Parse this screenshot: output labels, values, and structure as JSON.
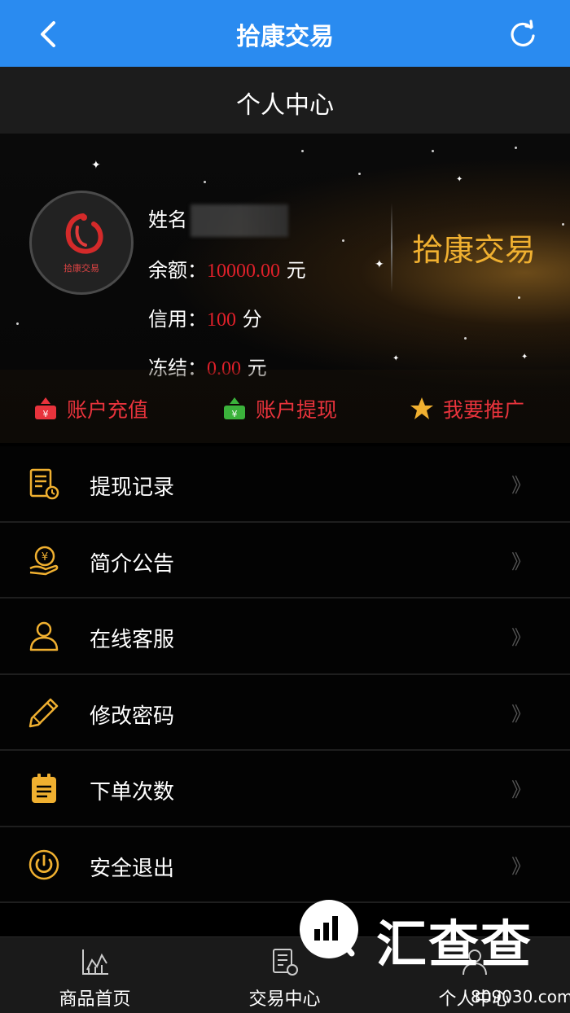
{
  "topbar": {
    "title": "拾康交易"
  },
  "subbar": {
    "title": "个人中心"
  },
  "profile": {
    "name_label": "姓名",
    "balance_label": "余额：",
    "balance_value": "10000.00",
    "balance_unit": "元",
    "credit_label": "信用：",
    "credit_value": "100",
    "credit_unit": "分",
    "frozen_label": "冻结：",
    "frozen_value": "0.00",
    "frozen_unit": "元",
    "avatar_text": "拾康交易",
    "brand": "拾康交易"
  },
  "actions": [
    {
      "label": "账户充值",
      "icon": "deposit-icon"
    },
    {
      "label": "账户提现",
      "icon": "withdraw-icon"
    },
    {
      "label": "我要推广",
      "icon": "star-icon"
    }
  ],
  "menu": [
    {
      "label": "提现记录",
      "icon": "record-icon"
    },
    {
      "label": "简介公告",
      "icon": "money-hand-icon"
    },
    {
      "label": "在线客服",
      "icon": "user-icon"
    },
    {
      "label": "修改密码",
      "icon": "pencil-icon"
    },
    {
      "label": "下单次数",
      "icon": "clipboard-icon"
    },
    {
      "label": "安全退出",
      "icon": "power-icon"
    }
  ],
  "menu_chevron": "》",
  "tabs": [
    {
      "label": "商品首页",
      "icon": "chart-icon"
    },
    {
      "label": "交易中心",
      "icon": "document-icon"
    },
    {
      "label": "个人中心",
      "icon": "person-icon"
    }
  ],
  "watermark": {
    "brand": "汇查查",
    "url": "809030.com"
  },
  "colors": {
    "nav_blue": "#2a8bf0",
    "accent_gold": "#f0b030",
    "value_red": "#e0202a",
    "action_red": "#e8333c"
  }
}
